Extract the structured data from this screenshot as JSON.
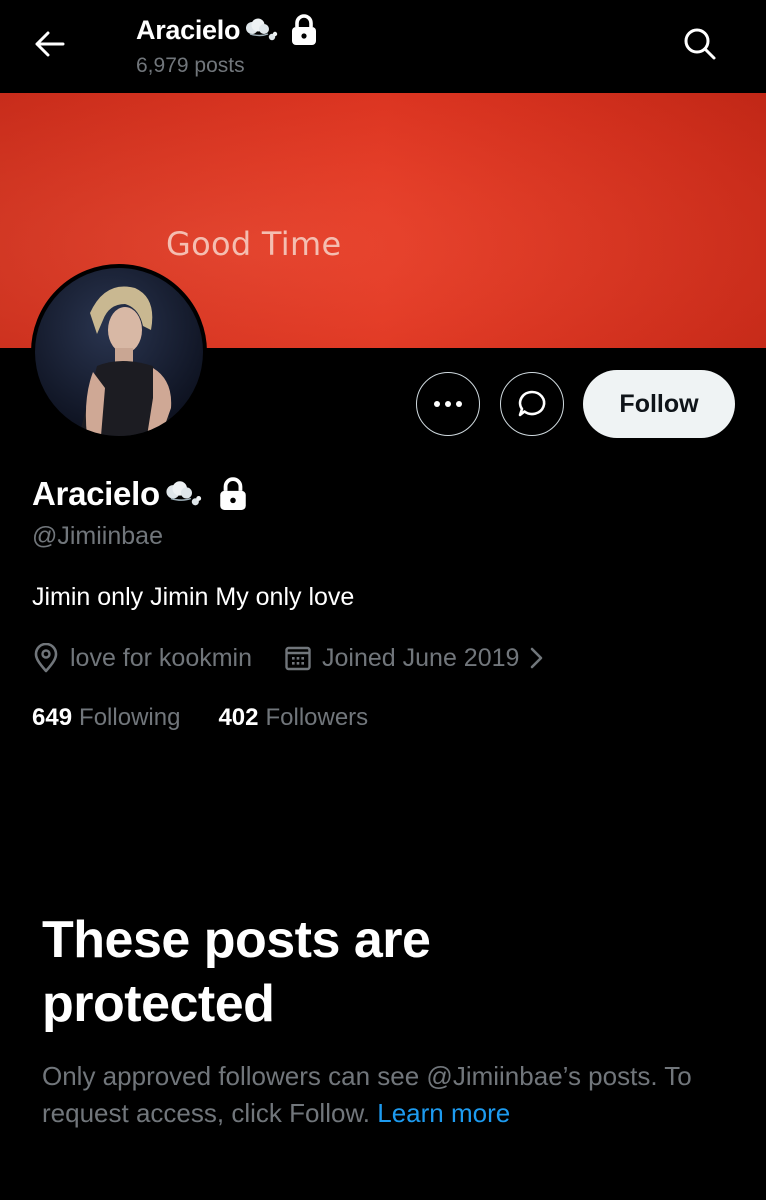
{
  "header": {
    "title": "Aracielo",
    "posts_count": "6,979 posts",
    "back_icon": "arrow-left-icon",
    "search_icon": "search-icon",
    "lock_icon": "lock-icon"
  },
  "banner": {
    "text": "Good Time",
    "color": "#e23a25"
  },
  "profile": {
    "display_name": "Aracielo",
    "handle": "@Jimiinbae",
    "bio": "Jimin only Jimin My only love",
    "location": "love for kookmin",
    "joined": "Joined June 2019",
    "following_count": "649",
    "following_label": "Following",
    "followers_count": "402",
    "followers_label": "Followers"
  },
  "actions": {
    "follow_label": "Follow",
    "more_icon": "more-horizontal-icon",
    "message_icon": "message-bubble-icon"
  },
  "protected": {
    "title": "These posts are protected",
    "description": "Only approved followers can see @Jimiinbae’s posts. To request access, click Follow.",
    "learn_more": "Learn more",
    "link_color": "#1d9bf0"
  }
}
